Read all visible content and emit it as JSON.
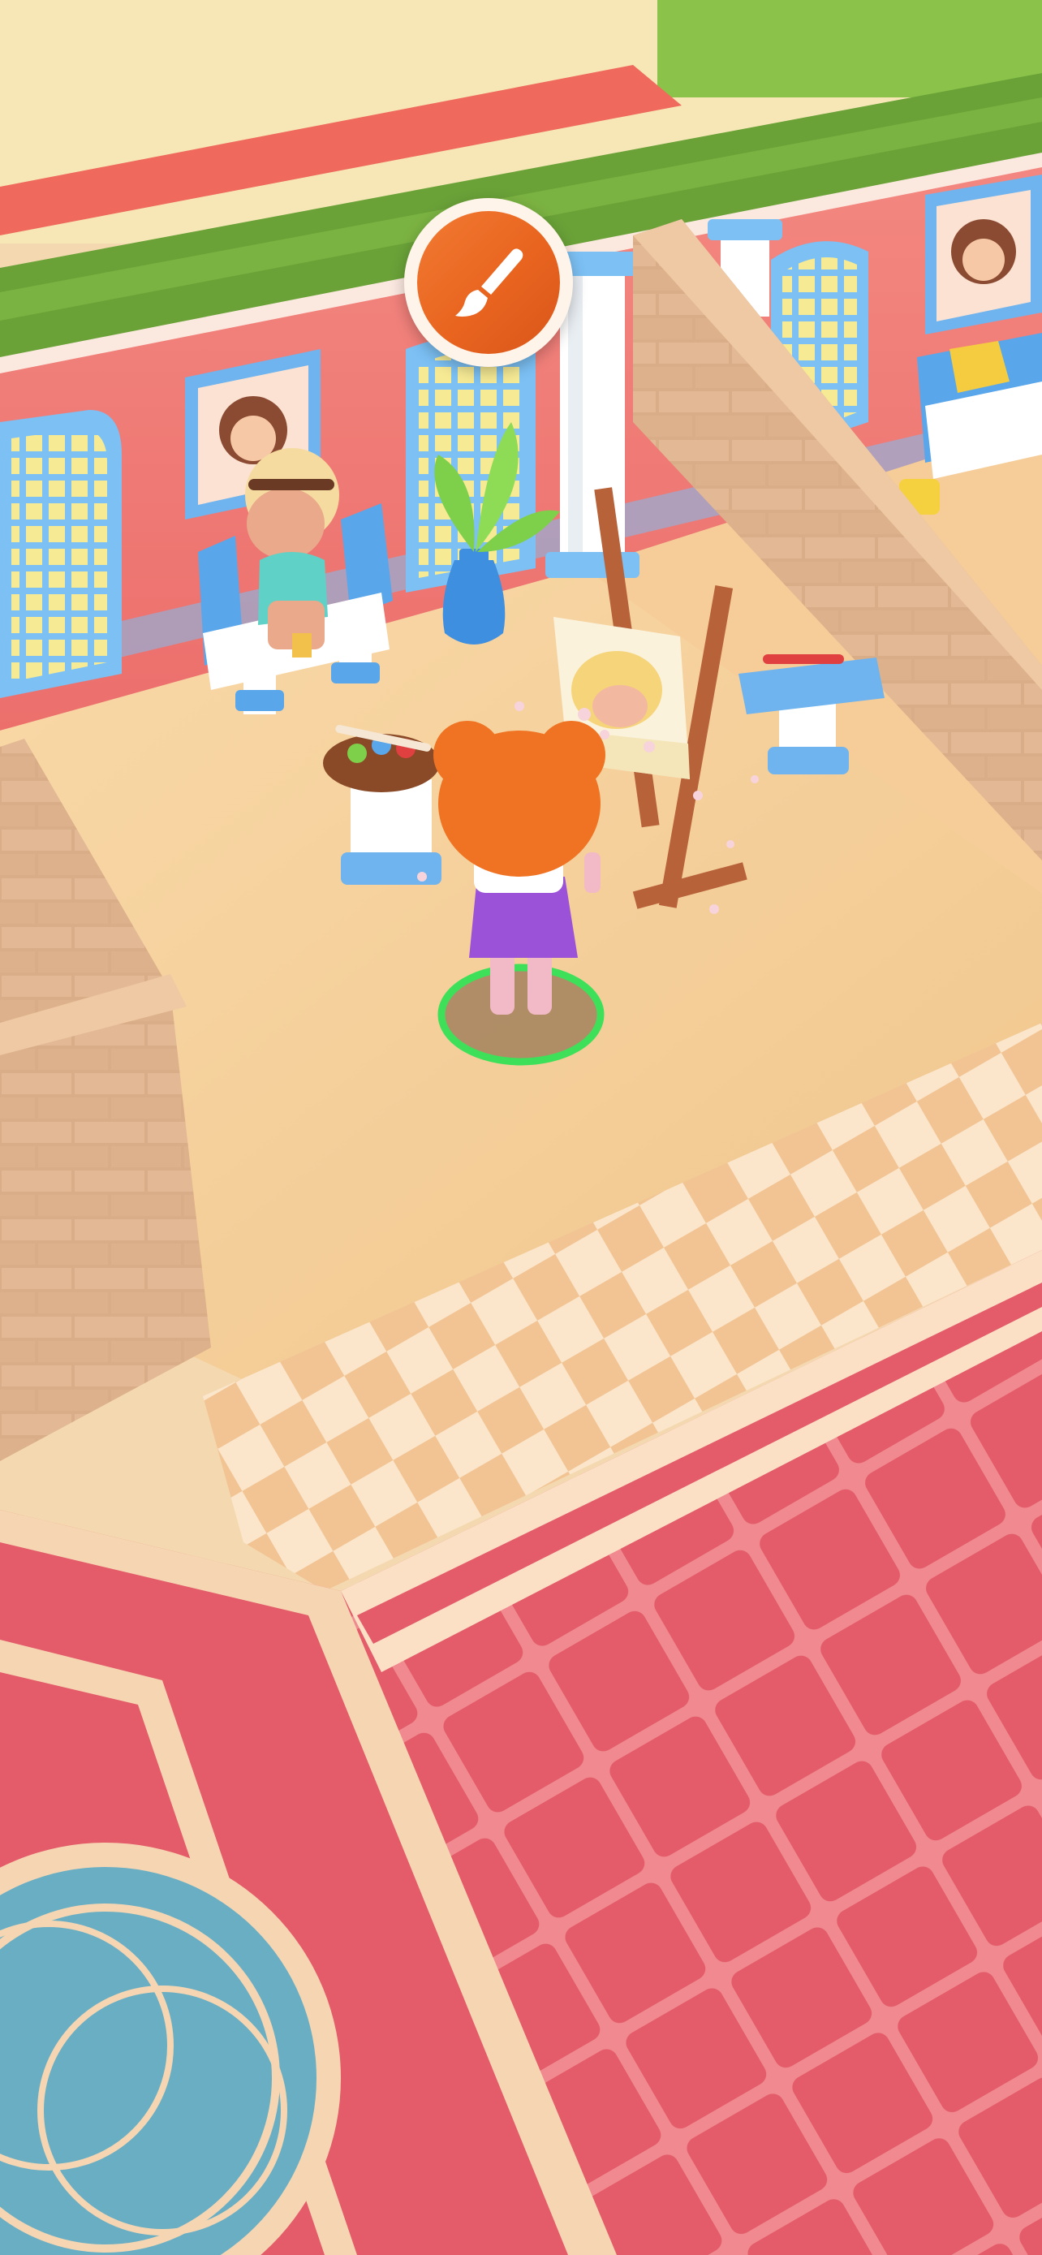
{
  "game": {
    "task_icon": "paintbrush-icon",
    "colors": {
      "wall": "#f07a78",
      "floor": "#f6cf9c",
      "carpet": "#e85f70",
      "accent_blue": "#6fb4ee",
      "action_orange": "#ea6a24",
      "selection_green": "#3ee05a"
    }
  }
}
